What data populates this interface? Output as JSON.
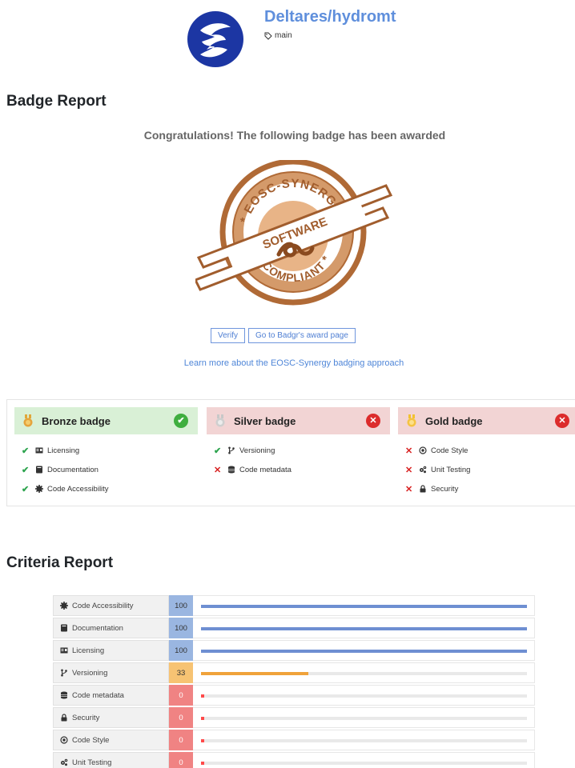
{
  "header": {
    "repo": "Deltares/hydromt",
    "branch": "main"
  },
  "badge_report": {
    "title": "Badge Report",
    "congrats": "Congratulations! The following badge has been awarded",
    "verify_label": "Verify",
    "award_page_label": "Go to Badgr's award page",
    "learn_more": "Learn more about the EOSC-Synergy badging approach",
    "badge_image": {
      "top_text": "EOSC-SYNERGY",
      "ribbon_text": "SOFTWARE",
      "bottom_text": "COMPLIANT"
    }
  },
  "badges": [
    {
      "name": "Bronze badge",
      "awarded": true,
      "criteria": [
        {
          "label": "Licensing",
          "pass": true,
          "icon": "id-card-icon"
        },
        {
          "label": "Documentation",
          "pass": true,
          "icon": "book-icon"
        },
        {
          "label": "Code Accessibility",
          "pass": true,
          "icon": "cog-icon"
        }
      ]
    },
    {
      "name": "Silver badge",
      "awarded": false,
      "criteria": [
        {
          "label": "Versioning",
          "pass": true,
          "icon": "branch-icon"
        },
        {
          "label": "Code metadata",
          "pass": false,
          "icon": "database-icon"
        }
      ]
    },
    {
      "name": "Gold badge",
      "awarded": false,
      "criteria": [
        {
          "label": "Code Style",
          "pass": false,
          "icon": "target-icon"
        },
        {
          "label": "Unit Testing",
          "pass": false,
          "icon": "cogs-icon"
        },
        {
          "label": "Security",
          "pass": false,
          "icon": "lock-icon"
        }
      ]
    }
  ],
  "criteria_report": {
    "title": "Criteria Report",
    "rows": [
      {
        "label": "Code Accessibility",
        "score": "100",
        "value": 100,
        "icon": "cog-icon"
      },
      {
        "label": "Documentation",
        "score": "100",
        "value": 100,
        "icon": "book-icon"
      },
      {
        "label": "Licensing",
        "score": "100",
        "value": 100,
        "icon": "id-card-icon"
      },
      {
        "label": "Versioning",
        "score": "33",
        "value": 33,
        "icon": "branch-icon"
      },
      {
        "label": "Code metadata",
        "score": "0",
        "value": 0,
        "icon": "database-icon"
      },
      {
        "label": "Security",
        "score": "0",
        "value": 0,
        "icon": "lock-icon"
      },
      {
        "label": "Code Style",
        "score": "0",
        "value": 0,
        "icon": "target-icon"
      },
      {
        "label": "Unit Testing",
        "score": "0",
        "value": 0,
        "icon": "cogs-icon"
      }
    ]
  },
  "colors": {
    "link": "#5f8fdc",
    "pass": "#2ea44f",
    "fail": "#d82020",
    "bar_full": "#6e8fd2",
    "bar_partial": "#f0a23a",
    "bar_zero": "#ff4a4a"
  }
}
